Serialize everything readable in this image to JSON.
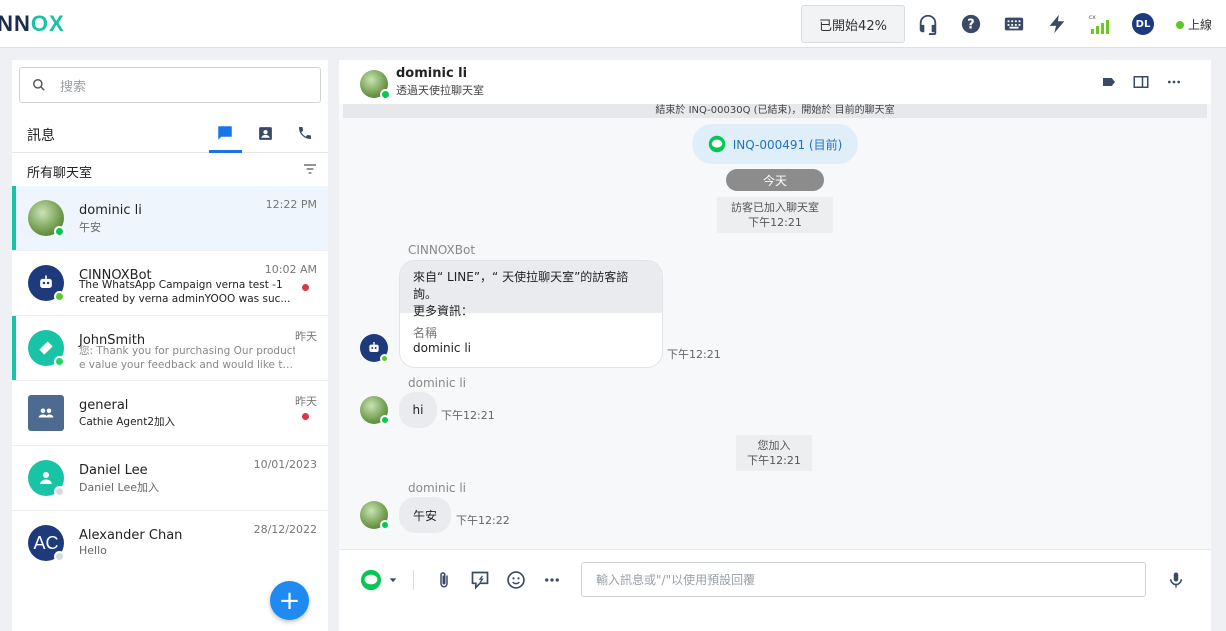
{
  "brand": {
    "logo_main": "INN",
    "logo_accent": "OX"
  },
  "topbar": {
    "progress_label": "已開始42%",
    "signal_label": "cx",
    "user_initials": "DL",
    "status": "上線",
    "colors": {
      "online": "#5cc92a",
      "accent": "#19c3a6",
      "primary": "#1f8af2"
    }
  },
  "left": {
    "search_placeholder": "搜索",
    "messages_title": "訊息",
    "filter_label": "所有聊天室",
    "conversations": [
      {
        "name": "dominic li",
        "preview": "午安",
        "time": "12:22 PM"
      },
      {
        "name": "CINNOXBot",
        "preview_line1": "The WhatsApp Campaign verna test -1",
        "preview_line2": "created by verna adminYOOO was suc...",
        "time": "10:02 AM"
      },
      {
        "name": "JohnSmith",
        "preview_line1": "您: Thank you for purchasing Our product! W",
        "preview_line2": "e value your feedback and would like to lear...",
        "time": "昨天"
      },
      {
        "name": "general",
        "preview": "Cathie Agent2加入",
        "time": "昨天"
      },
      {
        "name": "Daniel Lee",
        "preview": "Daniel Lee加入",
        "time": "10/01/2023"
      },
      {
        "name": "Alexander Chan",
        "initials": "AC",
        "preview": "Hello",
        "time": "28/12/2022"
      }
    ],
    "fab_label": "+"
  },
  "chat": {
    "header_name": "dominic li",
    "header_via": "透過天使拉聊天室",
    "system_bar": "結束於 INQ-00030Q (已結束)，開始於 目前的聊天室",
    "inquiry": "INQ-000491 (目前)",
    "date_divider": "今天",
    "visitor_joined": "訪客已加入聊天室",
    "visitor_joined_time": "下午12:21",
    "bot_sender": "CINNOXBot",
    "bot_text_line1": "來自“ LINE”，“ 天使拉聊天室”的訪客諮詢。",
    "bot_text_line2": "更多資訊：",
    "bot_field_key": "名稱",
    "bot_field_value": "dominic li",
    "bot_time": "下午12:21",
    "msg1_sender": "dominic li",
    "msg1_text": "hi",
    "msg1_time": "下午12:21",
    "you_joined": "您加入",
    "you_joined_time": "下午12:21",
    "msg2_sender": "dominic li",
    "msg2_text": "午安",
    "msg2_time": "下午12:22"
  },
  "composer": {
    "placeholder": "輸入訊息或\"/\"以使用預設回覆"
  }
}
